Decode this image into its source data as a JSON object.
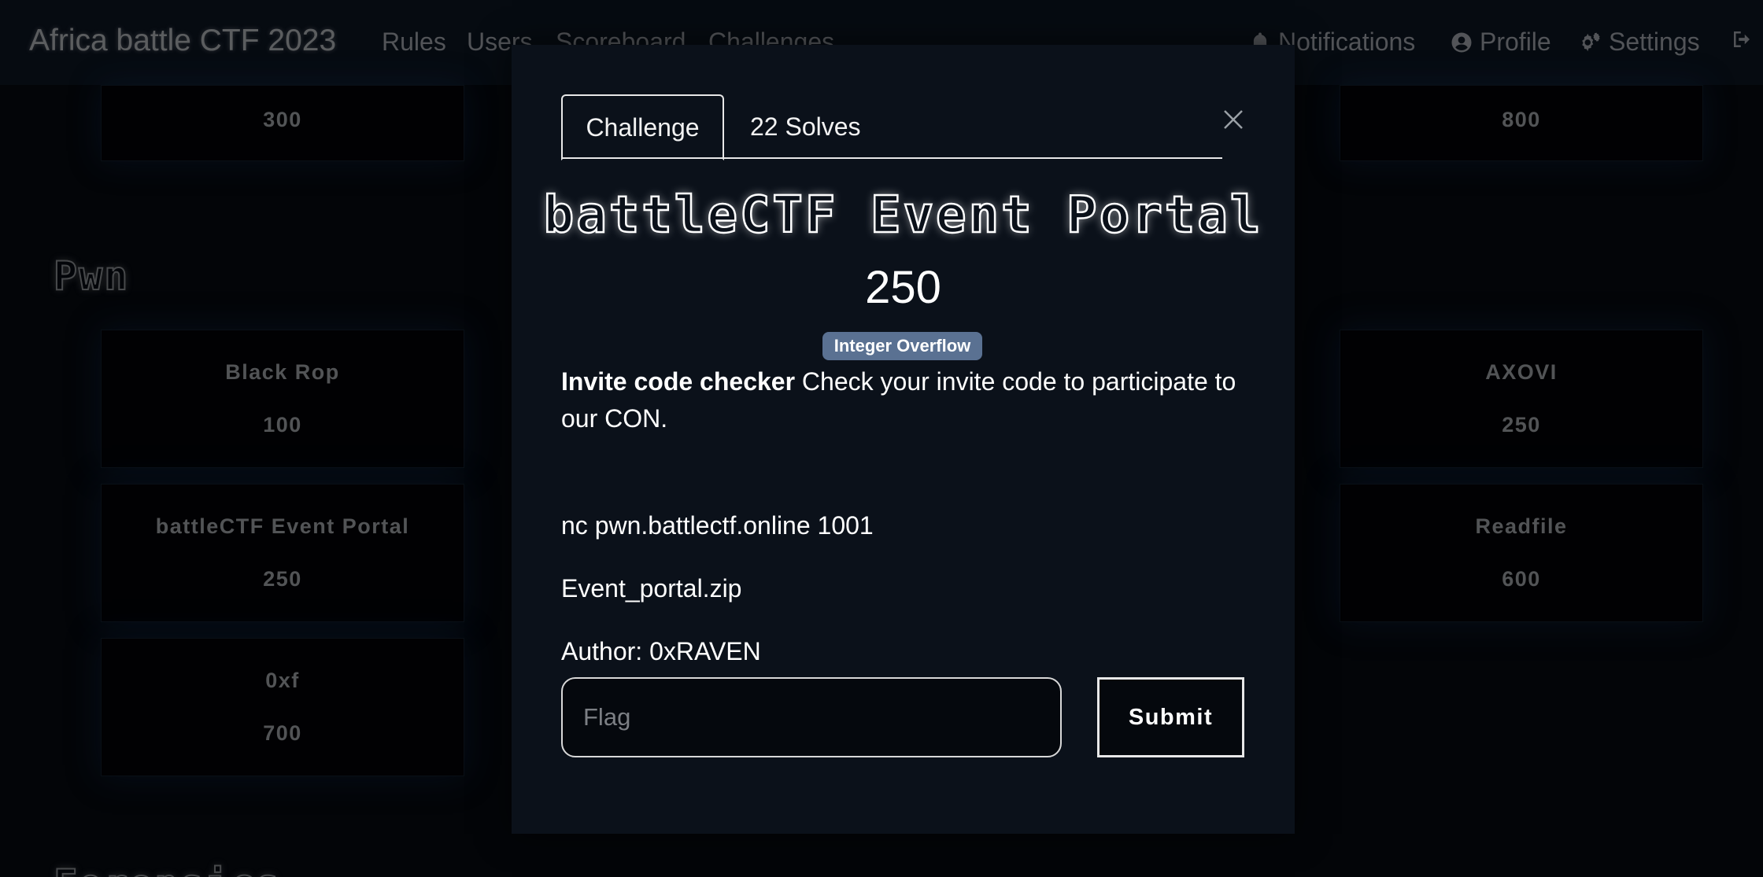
{
  "navbar": {
    "brand": "Africa battle CTF 2023",
    "links": [
      "Rules",
      "Users",
      "Scoreboard",
      "Challenges"
    ],
    "notifications": "Notifications",
    "profile": "Profile",
    "settings": "Settings"
  },
  "background": {
    "top_left_value": "300",
    "top_right_value": "800",
    "section_title": "Pwn",
    "next_section_title": "Forensics",
    "cards": [
      {
        "name": "Black Rop",
        "value": "100"
      },
      {
        "name": "battleCTF Event Portal",
        "value": "250"
      },
      {
        "name": "0xf",
        "value": "700"
      },
      {
        "name": "AXOVI",
        "value": "250"
      },
      {
        "name": "Readfile",
        "value": "600"
      }
    ]
  },
  "modal": {
    "tabs": {
      "challenge": "Challenge",
      "solves": "22 Solves"
    },
    "title": "battleCTF Event Portal",
    "value": "250",
    "tag": "Integer Overflow",
    "description_bold": "Invite code checker",
    "description_rest": " Check your invite code to participate to our CON.",
    "connection": "nc pwn.battlectf.online 1001",
    "file": "Event_portal.zip",
    "author": "Author: 0xRAVEN",
    "flag_placeholder": "Flag",
    "submit_label": "Submit"
  }
}
